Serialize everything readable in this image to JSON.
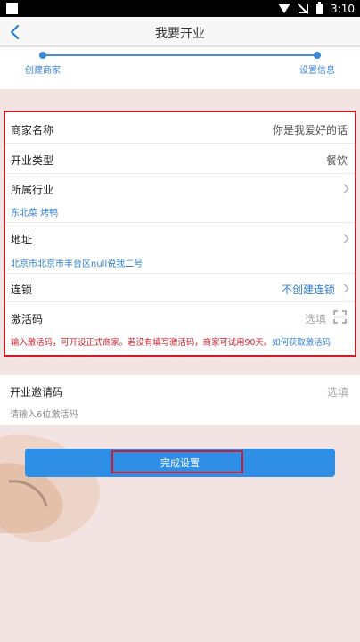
{
  "status_bar": {
    "time": "3:10"
  },
  "header": {
    "title": "我要开业"
  },
  "stepper": {
    "step1": "创建商家",
    "step2": "设置信息"
  },
  "form": {
    "name": {
      "label": "商家名称",
      "value": "你是我爱好的话"
    },
    "type": {
      "label": "开业类型",
      "value": "餐饮"
    },
    "industry": {
      "label": "所属行业",
      "value": "东北菜  烤鸭"
    },
    "address": {
      "label": "地址",
      "value": "北京市北京市丰台区null说我二号"
    },
    "chain": {
      "label": "连锁",
      "value": "不创建连锁"
    },
    "activation": {
      "label": "激活码",
      "placeholder": "选填",
      "hint": "输入激活码，可开设正式商家。若没有填写激活码，商家可试用90天。",
      "hint_link": "如何获取激活码"
    }
  },
  "invite": {
    "label": "开业邀请码",
    "placeholder": "选填",
    "sub": "请输入6位激活码"
  },
  "submit": {
    "label": "完成设置"
  },
  "colors": {
    "accent": "#2f8fe6",
    "highlight_border": "#d31b2c",
    "link": "#2f7fd3"
  }
}
